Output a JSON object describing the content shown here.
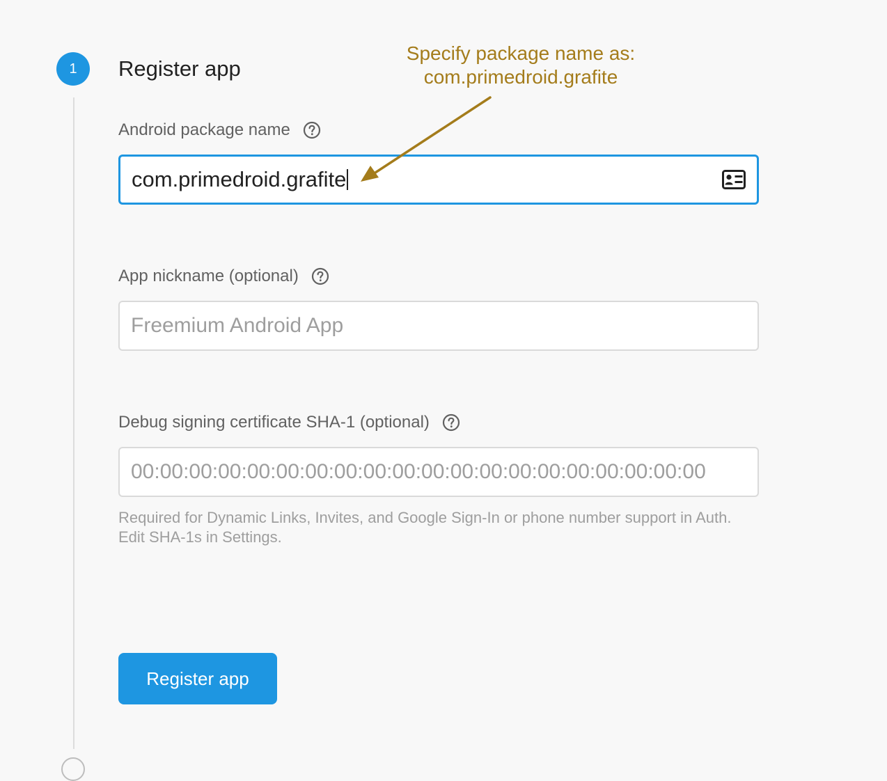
{
  "step": {
    "number": "1",
    "title": "Register app"
  },
  "package_field": {
    "label": "Android package name",
    "value": "com.primedroid.grafite"
  },
  "nickname_field": {
    "label": "App nickname (optional)",
    "placeholder": "Freemium Android App"
  },
  "sha_field": {
    "label": "Debug signing certificate SHA-1 (optional)",
    "placeholder": "00:00:00:00:00:00:00:00:00:00:00:00:00:00:00:00:00:00:00:00",
    "hint": "Required for Dynamic Links, Invites, and Google Sign-In or phone number support in Auth. Edit SHA-1s in Settings."
  },
  "register_button": {
    "label": "Register app"
  },
  "annotation": {
    "line1": "Specify package name as:",
    "line2": "com.primedroid.grafite"
  },
  "colors": {
    "accent": "#1e96e1",
    "annotation": "#a47c1b",
    "background": "#f8f8f8"
  },
  "icons": {
    "help": "question-circle-icon",
    "contact": "contact-card-icon"
  }
}
